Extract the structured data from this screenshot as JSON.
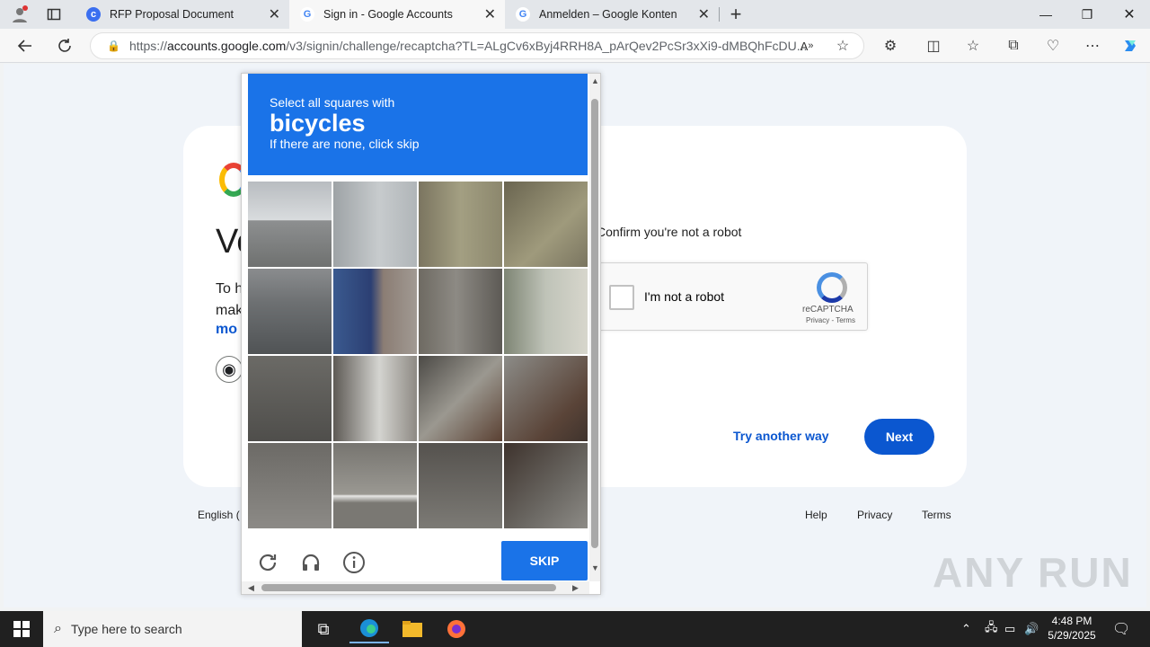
{
  "browser": {
    "tabs": [
      {
        "title": "RFP Proposal Document",
        "favicon": "c"
      },
      {
        "title": "Sign in - Google Accounts",
        "favicon": "G"
      },
      {
        "title": "Anmelden – Google Konten",
        "favicon": "G"
      }
    ],
    "url_prefix": "https://",
    "url_domain": "accounts.google.com",
    "url_path": "/v3/signin/challenge/recaptcha?TL=ALgCv6xByj4RRH8A_pArQev2PcSr3xXi9-dMBQhFcDU..."
  },
  "signin": {
    "heading_partial": "Ve",
    "desc_line1": "To h",
    "desc_line2": "mak",
    "more_partial": "mo",
    "confirm_text": "Confirm you're not a robot",
    "checkbox_label": "I'm not a robot",
    "recaptcha_brand": "reCAPTCHA",
    "recaptcha_terms": "Privacy - Terms",
    "try_another": "Try another way",
    "next": "Next"
  },
  "footer": {
    "language": "English (",
    "help": "Help",
    "privacy": "Privacy",
    "terms": "Terms"
  },
  "challenge": {
    "line1": "Select all squares with",
    "target": "bicycles",
    "line3": "If there are none, click skip",
    "skip": "SKIP"
  },
  "watermark": "ANY RUN",
  "taskbar": {
    "search_placeholder": "Type here to search",
    "time": "4:48 PM",
    "date": "5/29/2025"
  }
}
